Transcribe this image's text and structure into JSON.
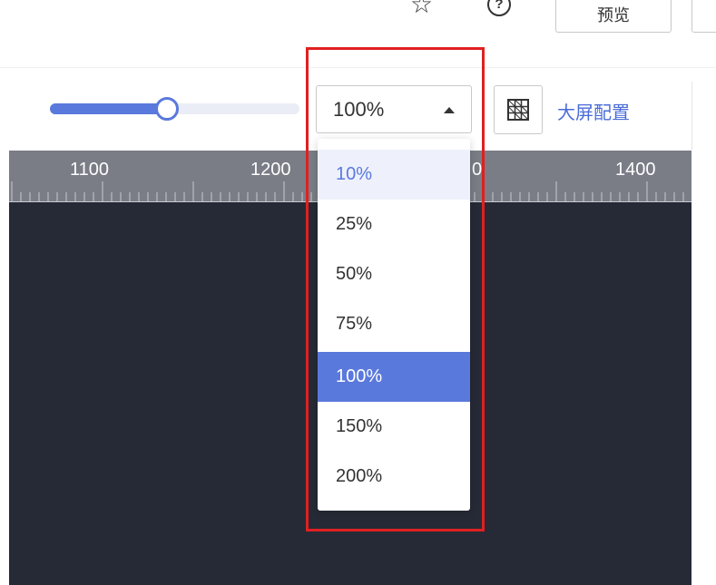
{
  "header": {
    "preview_label": "预览"
  },
  "toolbar": {
    "zoom_slider_fraction": 0.47,
    "zoom_value": "100%",
    "screen_config_label": "大屏配置"
  },
  "ruler": {
    "labels": [
      "1100",
      "1200",
      "0",
      "1400"
    ]
  },
  "zoom_dropdown": {
    "options": [
      "10%",
      "25%",
      "50%",
      "75%",
      "100%",
      "150%",
      "200%"
    ],
    "hovered": "10%",
    "selected": "100%"
  },
  "icons": [
    "star-icon",
    "help-icon",
    "caret-up-icon",
    "grid-icon"
  ],
  "colors": {
    "accent": "#5a79dc",
    "link": "#4a6cd8",
    "canvas": "#262a36",
    "ruler": "#7a7d86",
    "highlight": "#e02020"
  }
}
